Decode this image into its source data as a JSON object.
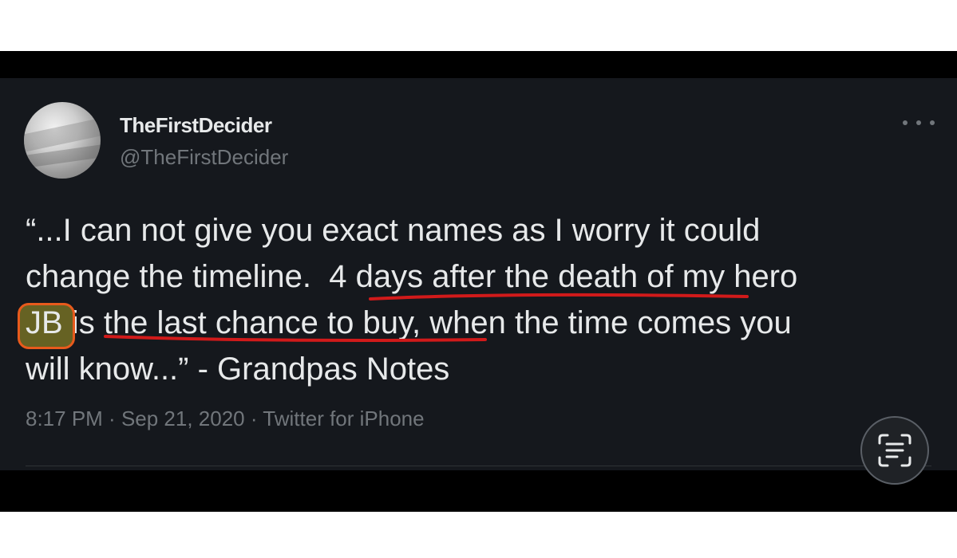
{
  "tweet": {
    "display_name": "TheFirstDecider",
    "handle": "@TheFirstDecider",
    "body": {
      "line1": "“...I can not give you exact names as I worry it could",
      "line2_a": "change the timeline.  ",
      "line2_b": "4 days after the death",
      "line2_c": " of my hero",
      "line3_jb": "JB",
      "line3_a": " is ",
      "line3_b": "the last chance to buy,",
      "line3_c": " when the time comes you",
      "line4": "will know...” - Grandpas Notes"
    },
    "meta": {
      "time": "8:17 PM",
      "separator": " · ",
      "date": "Sep 21, 2020",
      "source": "Twitter for iPhone"
    }
  },
  "colors": {
    "card_bg": "#15181d",
    "text": "#e7e9ea",
    "muted": "#71767b",
    "annotation_red": "#d11a1a",
    "highlight_orange": "#e85a1c"
  },
  "icons": {
    "more": "more-horizontal-icon",
    "scan": "live-text-scan-icon"
  }
}
